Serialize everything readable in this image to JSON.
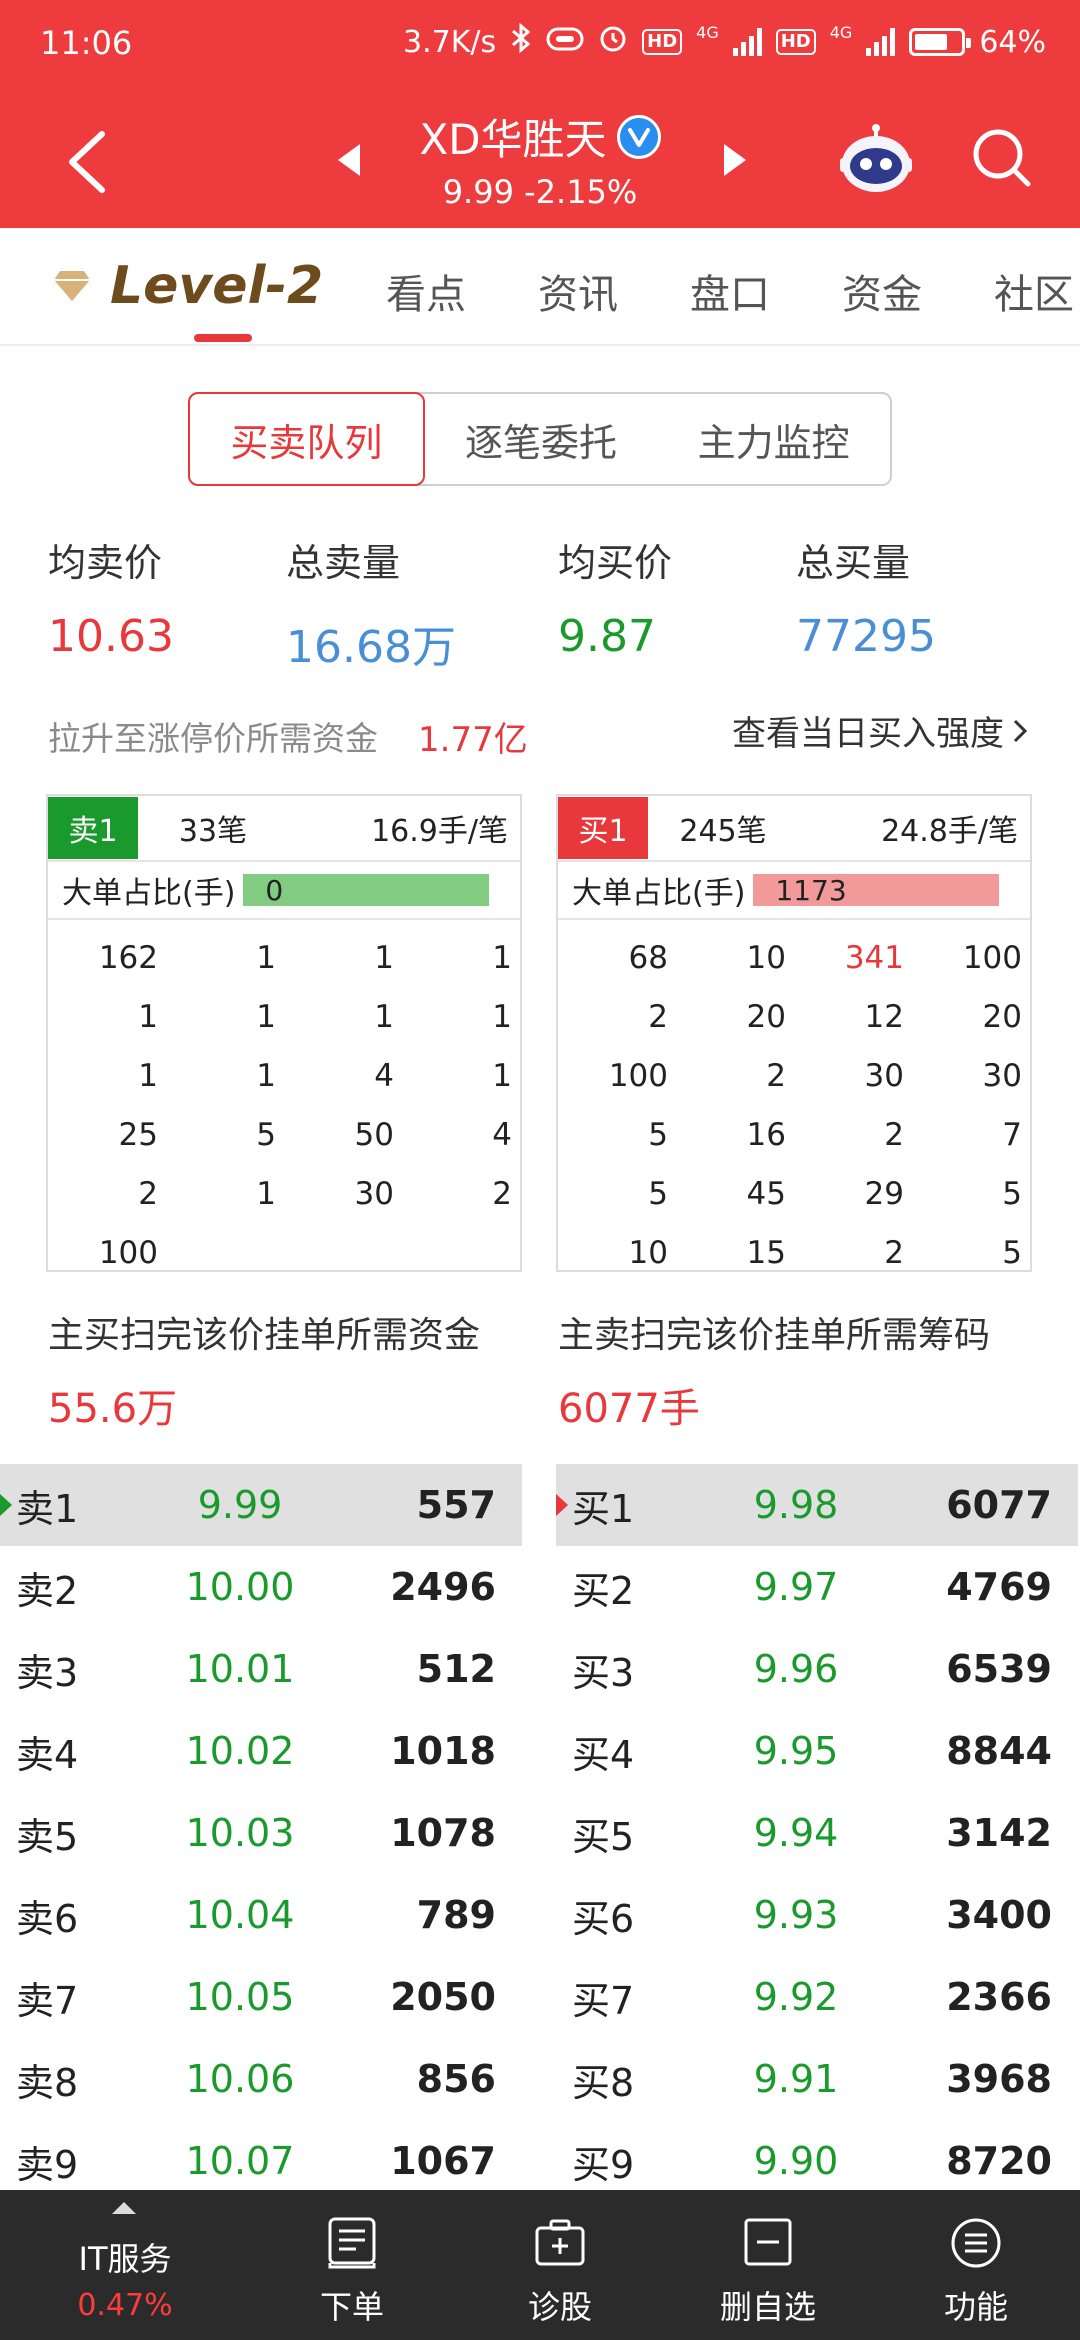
{
  "status_bar": {
    "time": "11:06",
    "net_speed": "3.7K/s",
    "hd1": "HD",
    "net1": "4G",
    "hd2": "HD",
    "net2": "4G",
    "battery": "64%"
  },
  "header": {
    "title": "XD华胜天",
    "price_line": "9.99  -2.15%",
    "colors": {
      "brand_red": "#ee3b3e",
      "verified_blue": "#2a8df0"
    }
  },
  "tabs": {
    "level2": "Level-2",
    "items": [
      "看点",
      "资讯",
      "盘口",
      "资金",
      "社区"
    ]
  },
  "segmented": {
    "items": [
      "买卖队列",
      "逐笔委托",
      "主力监控"
    ],
    "active_index": 0
  },
  "summary": {
    "avg_sell_label": "均卖价",
    "avg_sell_value": "10.63",
    "total_sell_label": "总卖量",
    "total_sell_value": "16.68万",
    "avg_buy_label": "均买价",
    "avg_buy_value": "9.87",
    "total_buy_label": "总买量",
    "total_buy_value": "77295"
  },
  "fund": {
    "label": "拉升至涨停价所需资金",
    "value": "1.77亿",
    "strength_link": "查看当日买入强度"
  },
  "sell_queue": {
    "tag": "卖1",
    "orders": "33笔",
    "per_order": "16.9手/笔",
    "ratio_label": "大单占比(手)",
    "ratio_value": "0",
    "rows": [
      [
        "162",
        "1",
        "1",
        "1"
      ],
      [
        "1",
        "1",
        "1",
        "1"
      ],
      [
        "1",
        "1",
        "4",
        "1"
      ],
      [
        "25",
        "5",
        "50",
        "4"
      ],
      [
        "2",
        "1",
        "30",
        "2"
      ],
      [
        "100",
        "",
        "",
        ""
      ]
    ]
  },
  "buy_queue": {
    "tag": "买1",
    "orders": "245笔",
    "per_order": "24.8手/笔",
    "ratio_label": "大单占比(手)",
    "ratio_value": "1173",
    "rows": [
      [
        "68",
        "10",
        "341",
        "100"
      ],
      [
        "2",
        "20",
        "12",
        "20"
      ],
      [
        "100",
        "2",
        "30",
        "30"
      ],
      [
        "5",
        "16",
        "2",
        "7"
      ],
      [
        "5",
        "45",
        "29",
        "5"
      ],
      [
        "10",
        "15",
        "2",
        "5"
      ]
    ]
  },
  "sweep": {
    "buy_label": "主买扫完该价挂单所需资金",
    "buy_value": "55.6万",
    "sell_label": "主卖扫完该价挂单所需筹码",
    "sell_value": "6077手"
  },
  "sell_book": [
    {
      "label": "卖1",
      "price": "9.99",
      "volume": "557"
    },
    {
      "label": "卖2",
      "price": "10.00",
      "volume": "2496"
    },
    {
      "label": "卖3",
      "price": "10.01",
      "volume": "512"
    },
    {
      "label": "卖4",
      "price": "10.02",
      "volume": "1018"
    },
    {
      "label": "卖5",
      "price": "10.03",
      "volume": "1078"
    },
    {
      "label": "卖6",
      "price": "10.04",
      "volume": "789"
    },
    {
      "label": "卖7",
      "price": "10.05",
      "volume": "2050"
    },
    {
      "label": "卖8",
      "price": "10.06",
      "volume": "856"
    },
    {
      "label": "卖9",
      "price": "10.07",
      "volume": "1067"
    }
  ],
  "buy_book": [
    {
      "label": "买1",
      "price": "9.98",
      "volume": "6077"
    },
    {
      "label": "买2",
      "price": "9.97",
      "volume": "4769"
    },
    {
      "label": "买3",
      "price": "9.96",
      "volume": "6539"
    },
    {
      "label": "买4",
      "price": "9.95",
      "volume": "8844"
    },
    {
      "label": "买5",
      "price": "9.94",
      "volume": "3142"
    },
    {
      "label": "买6",
      "price": "9.93",
      "volume": "3400"
    },
    {
      "label": "买7",
      "price": "9.92",
      "volume": "2366"
    },
    {
      "label": "买8",
      "price": "9.91",
      "volume": "3968"
    },
    {
      "label": "买9",
      "price": "9.90",
      "volume": "8720"
    }
  ],
  "bottom_bar": {
    "sector_label": "IT服务",
    "sector_change": "0.47%",
    "items": [
      "下单",
      "诊股",
      "删自选",
      "功能"
    ]
  }
}
